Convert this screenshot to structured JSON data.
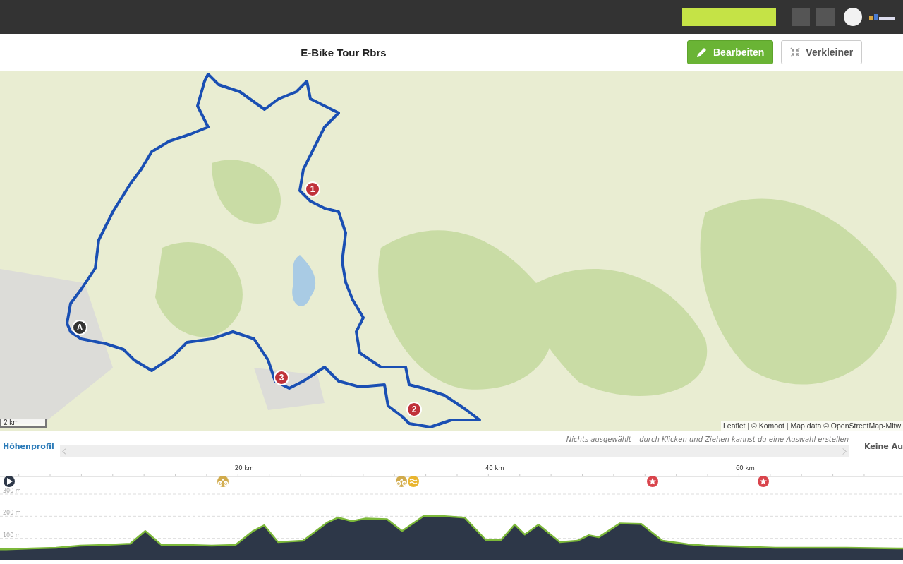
{
  "header": {
    "title": "E-Bike Tour Rbrs",
    "buttons": [
      {
        "label": "Bearbeiten",
        "kind": "edit"
      },
      {
        "label": "Verkleiner",
        "kind": "shrink"
      }
    ]
  },
  "map": {
    "markers": [
      {
        "label": "A",
        "kind": "start"
      },
      {
        "label": "1",
        "kind": "waypoint"
      },
      {
        "label": "3",
        "kind": "waypoint"
      },
      {
        "label": "2",
        "kind": "waypoint"
      }
    ],
    "scale": "2 km",
    "attribution": "Leaflet | © Komoot | Map data © OpenStreetMap-Mitw"
  },
  "elevation": {
    "menu": "Höhenprofil",
    "hint": "Nichts ausgewählt – durch Klicken und Ziehen kannst du eine Auswahl erstellen",
    "side_label": "Keine Au",
    "chart_data": {
      "type": "area",
      "x": [
        0.5,
        1.0,
        3.0,
        5.0,
        6.9,
        8.9,
        10.9,
        12.1,
        13.4,
        15.4,
        17.4,
        19.3,
        20.7,
        21.6,
        22.7,
        24.7,
        26.6,
        27.5,
        28.6,
        29.7,
        31.4,
        32.6,
        34.3,
        36.0,
        37.6,
        39.3,
        40.5,
        41.6,
        42.4,
        43.5,
        45.2,
        46.6,
        47.5,
        48.3,
        50.0,
        51.7,
        53.4,
        55.4,
        56.8,
        59.6,
        62.4,
        65.2,
        68.1,
        72.6
      ],
      "values": [
        50,
        50,
        54,
        57,
        67,
        70,
        76,
        133,
        70,
        70,
        67,
        70,
        133,
        159,
        83,
        89,
        171,
        194,
        178,
        190,
        187,
        133,
        200,
        200,
        194,
        92,
        92,
        162,
        117,
        162,
        83,
        89,
        114,
        105,
        168,
        165,
        89,
        73,
        67,
        63,
        57,
        57,
        57,
        54
      ],
      "xlim": [
        0.5,
        72.6
      ],
      "ylim": [
        0,
        300
      ],
      "grid": true,
      "xticks": [
        {
          "value": 20,
          "label": "20 km"
        },
        {
          "value": 40,
          "label": "40 km"
        },
        {
          "value": 60,
          "label": "60 km"
        }
      ],
      "yticks": [
        {
          "value": 100,
          "label": "100 m"
        },
        {
          "value": 200,
          "label": "200 m"
        },
        {
          "value": 300,
          "label": "300 m"
        }
      ]
    }
  }
}
